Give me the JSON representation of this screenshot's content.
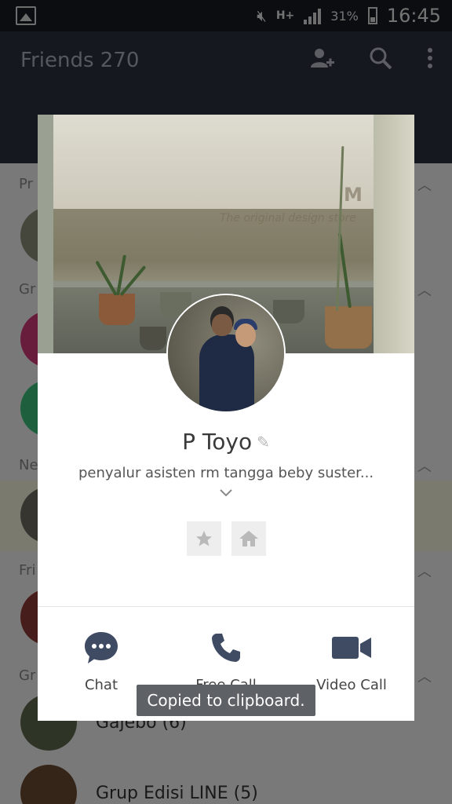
{
  "status_bar": {
    "network": "H+",
    "battery": "31%",
    "time": "16:45"
  },
  "header": {
    "title": "Friends 270",
    "icons": [
      "add-friend-icon",
      "search-icon",
      "more-icon"
    ]
  },
  "list": {
    "sections": [
      "Pr",
      "Gr",
      "Ne",
      "Fri",
      "Gr"
    ],
    "visible_rows": [
      {
        "name": "Gajebo (6)"
      },
      {
        "name": "Grup Edisi LINE (5)"
      }
    ]
  },
  "profile": {
    "cover_watermark": "The original design store",
    "cover_watermark_mark": "M",
    "name": "P Toyo",
    "status_message": "penyalur asisten rm tangga beby suster...",
    "actions": [
      {
        "label": "Chat",
        "icon": "chat-bubble-icon"
      },
      {
        "label": "Free Call",
        "icon": "phone-icon"
      },
      {
        "label": "Video Call",
        "icon": "video-camera-icon"
      }
    ],
    "accent_color": "#3f4a63"
  },
  "toast": {
    "text": "Copied to clipboard."
  }
}
